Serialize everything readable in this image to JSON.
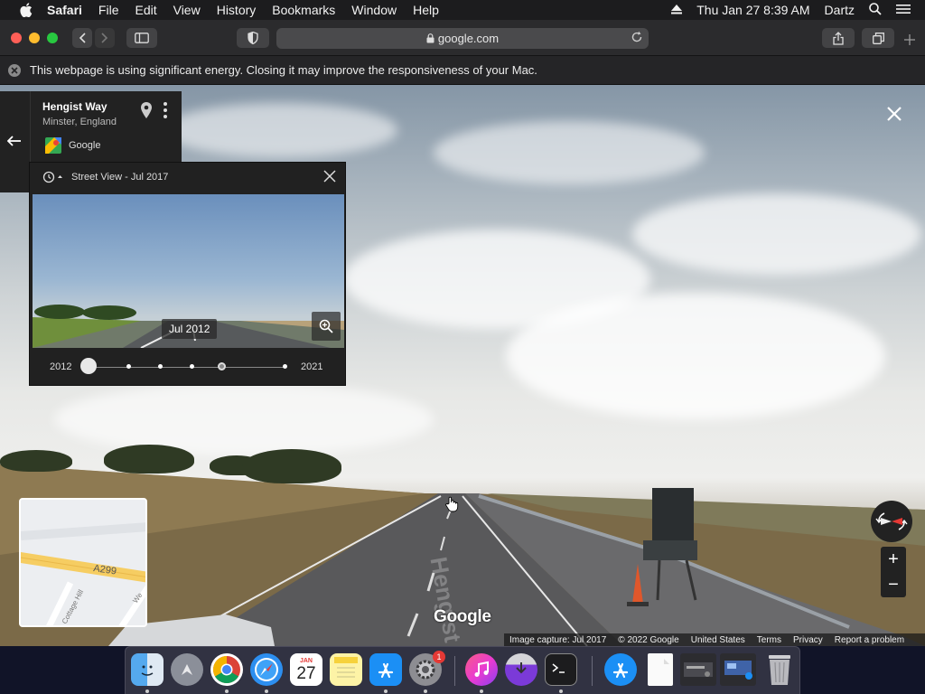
{
  "menubar": {
    "app": "Safari",
    "items": [
      "File",
      "Edit",
      "View",
      "History",
      "Bookmarks",
      "Window",
      "Help"
    ],
    "datetime": "Thu Jan 27  8:39 AM",
    "user": "Dartz"
  },
  "toolbar": {
    "url": "google.com"
  },
  "energy_banner": {
    "text": "This webpage is using significant energy. Closing it may improve the responsiveness of your Mac."
  },
  "place": {
    "title": "Hengist Way",
    "subtitle": "Minster, England",
    "source": "Google"
  },
  "time_panel": {
    "title": "Street View - Jul 2017",
    "date_label": "Jul 2012",
    "start_year": "2012",
    "end_year": "2021"
  },
  "minimap": {
    "road_label": "A299",
    "side_label_1": "Cottage Hill",
    "side_label_2": "We"
  },
  "overlay": {
    "logo": "Google",
    "road_text": "Hengist Way"
  },
  "footer": {
    "items": [
      "Image capture: Jul 2017",
      "© 2022 Google",
      "United States",
      "Terms",
      "Privacy",
      "Report a problem"
    ]
  },
  "dock": {
    "notification_badge": "1",
    "calendar_month": "JAN",
    "calendar_day": "27"
  },
  "colors": {
    "traffic_close": "#ff5f57",
    "traffic_min": "#febc2e",
    "traffic_max": "#28c840",
    "compass_red": "#e53935"
  }
}
